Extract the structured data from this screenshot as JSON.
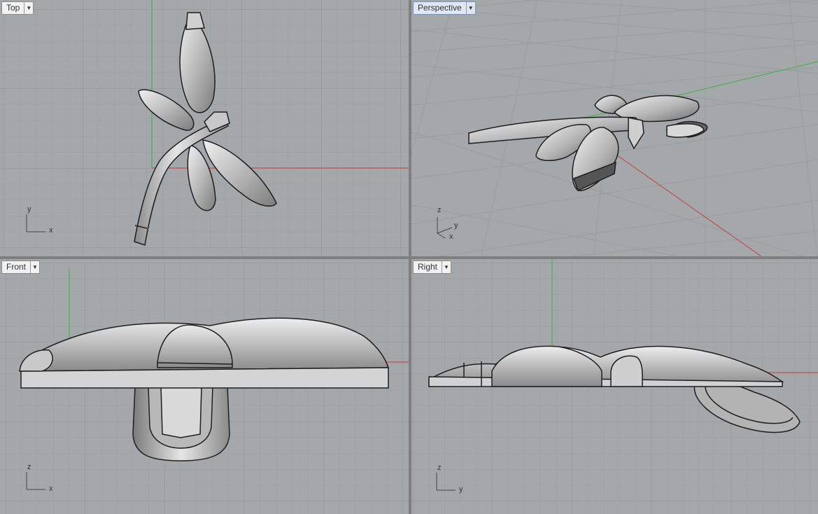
{
  "viewports": {
    "top": {
      "label": "Top",
      "axis_v": "y",
      "axis_h": "x"
    },
    "perspective": {
      "label": "Perspective",
      "axis_z": "z",
      "axis_y": "y",
      "axis_x": "x"
    },
    "front": {
      "label": "Front",
      "axis_v": "z",
      "axis_h": "x"
    },
    "right": {
      "label": "Right",
      "axis_v": "z",
      "axis_h": "y"
    }
  },
  "icons": {
    "viewport_menu": "chevron-down-icon"
  },
  "colors": {
    "grid_bg": "#a5a8ab",
    "grid_line": "#9b9ea1",
    "grid_major": "#8e9194",
    "x_axis": "#c0504d",
    "y_axis": "#4caf50",
    "model": "#bfbfbf"
  }
}
